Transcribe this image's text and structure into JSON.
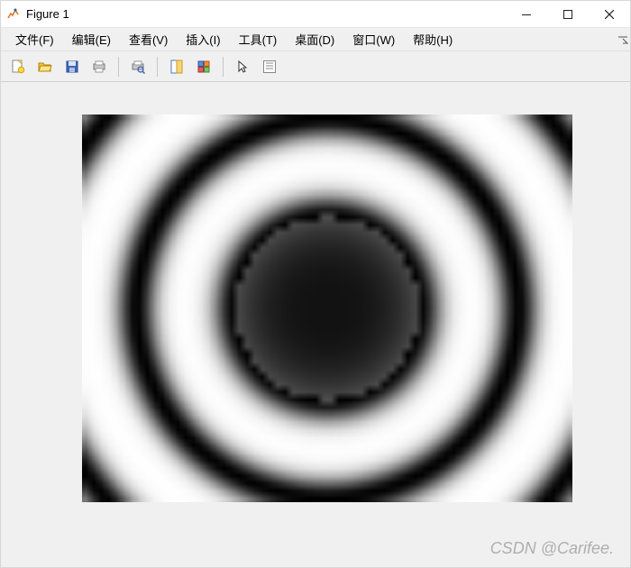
{
  "titlebar": {
    "title": "Figure 1"
  },
  "menubar": {
    "items": [
      {
        "label": "文件(F)"
      },
      {
        "label": "编辑(E)"
      },
      {
        "label": "查看(V)"
      },
      {
        "label": "插入(I)"
      },
      {
        "label": "工具(T)"
      },
      {
        "label": "桌面(D)"
      },
      {
        "label": "窗口(W)"
      },
      {
        "label": "帮助(H)"
      }
    ]
  },
  "toolbar": {
    "buttons": [
      "new-figure-icon",
      "open-icon",
      "save-icon",
      "print-icon",
      "|",
      "print-preview-icon",
      "|",
      "link-icon",
      "insert-colorbar-icon",
      "|",
      "pointer-icon",
      "plot-tools-icon"
    ]
  },
  "watermark": "CSDN @Carifee.",
  "chart_data": {
    "type": "heatmap",
    "title": "",
    "description": "Grayscale interference / concentric ring pattern",
    "xlim": [
      -1,
      1
    ],
    "ylim": [
      -1,
      1
    ],
    "rings_dark_radii": [
      0.0,
      0.62,
      0.95
    ],
    "center_dark_radius": 0.3,
    "image_pixelation": 64,
    "colormap": "gray"
  }
}
